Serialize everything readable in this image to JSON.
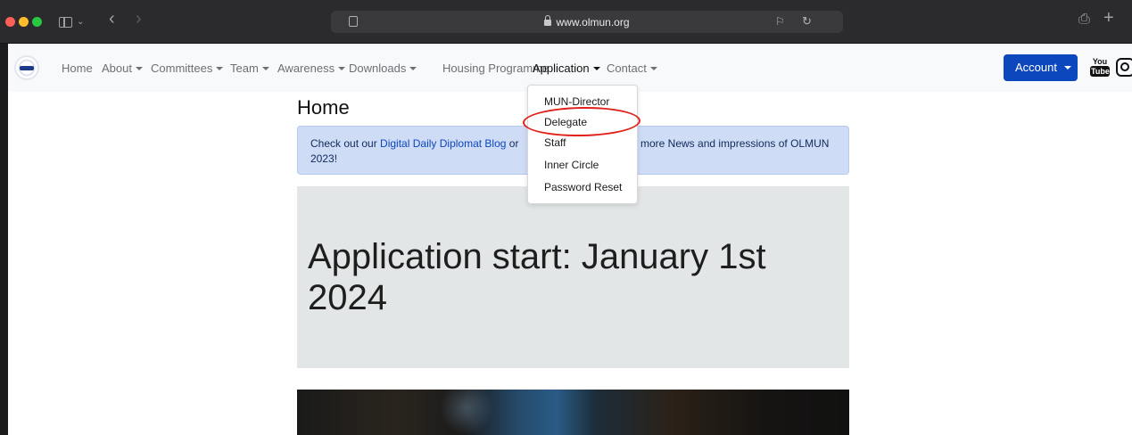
{
  "browser": {
    "url": "www.olmun.org",
    "back_glyph": "‹",
    "forward_glyph": "›",
    "share_glyph": "⎙",
    "new_tab_glyph": "+"
  },
  "navbar": {
    "logo_icon": "olmun-logo",
    "items": [
      {
        "label": "Home",
        "caret": false
      },
      {
        "label": "About",
        "caret": true
      },
      {
        "label": "Committees",
        "caret": true
      },
      {
        "label": "Team",
        "caret": true
      },
      {
        "label": "Awareness",
        "caret": true
      },
      {
        "label": "Downloads",
        "caret": true
      },
      {
        "label": "Housing Programme",
        "caret": false
      },
      {
        "label": "Application",
        "caret": true,
        "active": true
      },
      {
        "label": "Contact",
        "caret": true
      }
    ],
    "account_label": "Account",
    "youtube_top": "You",
    "youtube_bottom": "Tube",
    "accent_color": "#0d47bd"
  },
  "dropdown": {
    "items": [
      "MUN-Director",
      "Delegate",
      "Staff",
      "Inner Circle",
      "Password Reset"
    ],
    "highlighted": "Delegate",
    "highlight_color": "#e0201a"
  },
  "main": {
    "title": "Home",
    "alert": {
      "prefix": "Check out our ",
      "link": "Digital Daily Diplomat Blog",
      "after_link": " or",
      "tail": "more News and impressions of OLMUN",
      "line2": "2023!"
    },
    "hero_title": "Application start: January 1st 2024"
  }
}
